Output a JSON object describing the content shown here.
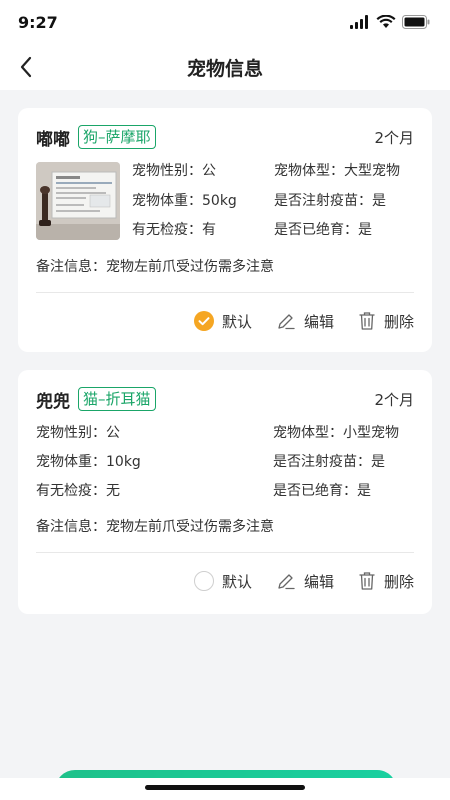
{
  "status_bar": {
    "time": "9:27"
  },
  "header": {
    "title": "宠物信息"
  },
  "pets": [
    {
      "name": "嘟嘟",
      "breed": "狗–萨摩耶",
      "age": "2个月",
      "fields": {
        "gender": "宠物性别：公",
        "size": "宠物体型：大型宠物",
        "weight": "宠物体重：50kg",
        "vaccinated": "是否注射疫苗：是",
        "quarantine": "有无检疫：有",
        "neutered": "是否已绝育：是"
      },
      "note": "备注信息：宠物左前爪受过伤需多注意",
      "is_default": true
    },
    {
      "name": "兜兜",
      "breed": "猫–折耳猫",
      "age": "2个月",
      "fields": {
        "gender": "宠物性别：公",
        "size": "宠物体型：小型宠物",
        "weight": "宠物体重：10kg",
        "vaccinated": "是否注射疫苗：是",
        "quarantine": "有无检疫：无",
        "neutered": "是否已绝育：是"
      },
      "note": "备注信息：宠物左前爪受过伤需多注意",
      "is_default": false
    }
  ],
  "actions": {
    "default_label": "默认",
    "edit_label": "编辑",
    "delete_label": "删除"
  },
  "icons": {
    "back": "chevron-left-icon",
    "check": "check-circle-icon",
    "edit": "pencil-icon",
    "delete": "trash-icon"
  },
  "colors": {
    "accent_green": "#1aa568",
    "checked_orange": "#f5a623",
    "button_gradient_start": "#1ec18a",
    "button_gradient_end": "#1ad0a0"
  }
}
